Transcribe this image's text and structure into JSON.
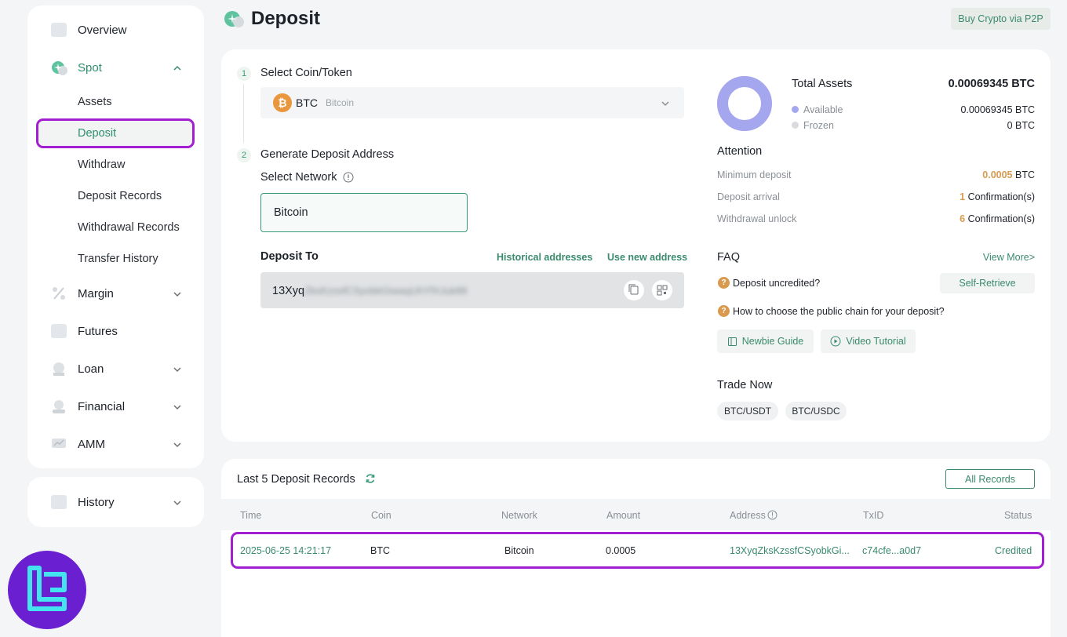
{
  "sidebar": {
    "overview": "Overview",
    "spot": "Spot",
    "spot_items": [
      "Assets",
      "Deposit",
      "Withdraw",
      "Deposit Records",
      "Withdrawal Records",
      "Transfer History"
    ],
    "margin": "Margin",
    "futures": "Futures",
    "loan": "Loan",
    "financial": "Financial",
    "amm": "AMM",
    "history": "History"
  },
  "header": {
    "title": "Deposit",
    "p2p_button": "Buy Crypto via P2P"
  },
  "steps": {
    "step1_num": "1",
    "step1_label": "Select Coin/Token",
    "coin_symbol": "BTC",
    "coin_name": "Bitcoin",
    "step2_num": "2",
    "step2_label": "Generate Deposit Address",
    "select_network_label": "Select Network",
    "network_value": "Bitcoin",
    "deposit_to_label": "Deposit To",
    "historical_link": "Historical addresses",
    "new_address_link": "Use new address",
    "address_prefix": "13Xyq",
    "address_blurred": "ZksKzssfCSyobkGiwaqUhYfXJuk88"
  },
  "assets": {
    "total_label": "Total Assets",
    "total_value": "0.00069345 BTC",
    "available_label": "Available",
    "available_value": "0.00069345 BTC",
    "frozen_label": "Frozen",
    "frozen_value": "0 BTC",
    "available_color": "#a4a6ee",
    "frozen_color": "#d9dbde"
  },
  "attention": {
    "title": "Attention",
    "min_label": "Minimum deposit",
    "min_value": "0.0005",
    "min_unit": "BTC",
    "arrival_label": "Deposit arrival",
    "arrival_value": "1",
    "arrival_unit": "Confirmation(s)",
    "unlock_label": "Withdrawal unlock",
    "unlock_value": "6",
    "unlock_unit": "Confirmation(s)"
  },
  "faq": {
    "title": "FAQ",
    "view_more": "View More>",
    "q1": "Deposit uncredited?",
    "self_retrieve": "Self-Retrieve",
    "q2": "How to choose the public chain for your deposit?",
    "newbie_guide": "Newbie Guide",
    "video_tutorial": "Video Tutorial"
  },
  "trade": {
    "title": "Trade Now",
    "pairs": [
      "BTC/USDT",
      "BTC/USDC"
    ]
  },
  "records": {
    "title": "Last 5 Deposit Records",
    "all_records": "All Records",
    "columns": [
      "Time",
      "Coin",
      "Network",
      "Amount",
      "Address",
      "TxID",
      "Status"
    ],
    "rows": [
      {
        "time": "2025-06-25 14:21:17",
        "coin": "BTC",
        "network": "Bitcoin",
        "amount": "0.0005",
        "address": "13XyqZksKzssfCSyobkGi...",
        "txid": "c74cfe...a0d7",
        "status": "Credited"
      }
    ]
  }
}
